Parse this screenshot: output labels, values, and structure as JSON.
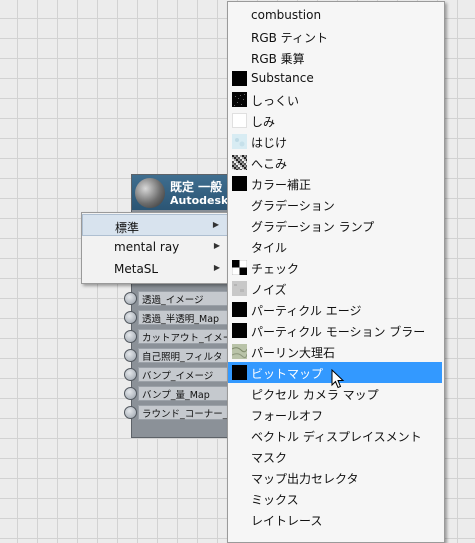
{
  "node": {
    "title": "既定 一般",
    "subtitle": "Autodesk",
    "slots": [
      "透過_イメージ",
      "透過_半透明_Map",
      "カットアウト_イメージ",
      "自己照明_フィルタ",
      "バンプ_イメージ",
      "バンプ_量_Map",
      "ラウンド_コーナー_ラ"
    ]
  },
  "submenu_small": {
    "items": [
      {
        "label": "標準",
        "has_submenu": true,
        "active": true
      },
      {
        "label": "mental ray",
        "has_submenu": true,
        "active": false
      },
      {
        "label": "MetaSL",
        "has_submenu": true,
        "active": false
      }
    ],
    "arrow_glyph": "▶"
  },
  "submenu_maps": {
    "items": [
      {
        "label": "combustion",
        "icon": "none"
      },
      {
        "label": "RGB ティント",
        "icon": "none"
      },
      {
        "label": "RGB 乗算",
        "icon": "none"
      },
      {
        "label": "Substance",
        "icon": "black"
      },
      {
        "label": "しっくい",
        "icon": "speckle"
      },
      {
        "label": "しみ",
        "icon": "white"
      },
      {
        "label": "はじけ",
        "icon": "light-blue"
      },
      {
        "label": "へこみ",
        "icon": "noise"
      },
      {
        "label": "カラー補正",
        "icon": "black"
      },
      {
        "label": "グラデーション",
        "icon": "none"
      },
      {
        "label": "グラデーション ランプ",
        "icon": "none"
      },
      {
        "label": "タイル",
        "icon": "none"
      },
      {
        "label": "チェック",
        "icon": "checker"
      },
      {
        "label": "ノイズ",
        "icon": "gray-noise"
      },
      {
        "label": "パーティクル エージ",
        "icon": "black"
      },
      {
        "label": "パーティクル モーション ブラー",
        "icon": "black"
      },
      {
        "label": "パーリン大理石",
        "icon": "marble"
      },
      {
        "label": "ビットマップ",
        "icon": "black",
        "active": true
      },
      {
        "label": "ピクセル カメラ マップ",
        "icon": "none"
      },
      {
        "label": "フォールオフ",
        "icon": "none"
      },
      {
        "label": "ベクトル ディスプレイスメント",
        "icon": "none"
      },
      {
        "label": "マスク",
        "icon": "none"
      },
      {
        "label": "マップ出力セレクタ",
        "icon": "none"
      },
      {
        "label": "ミックス",
        "icon": "none"
      },
      {
        "label": "レイトレース",
        "icon": "none"
      }
    ]
  }
}
